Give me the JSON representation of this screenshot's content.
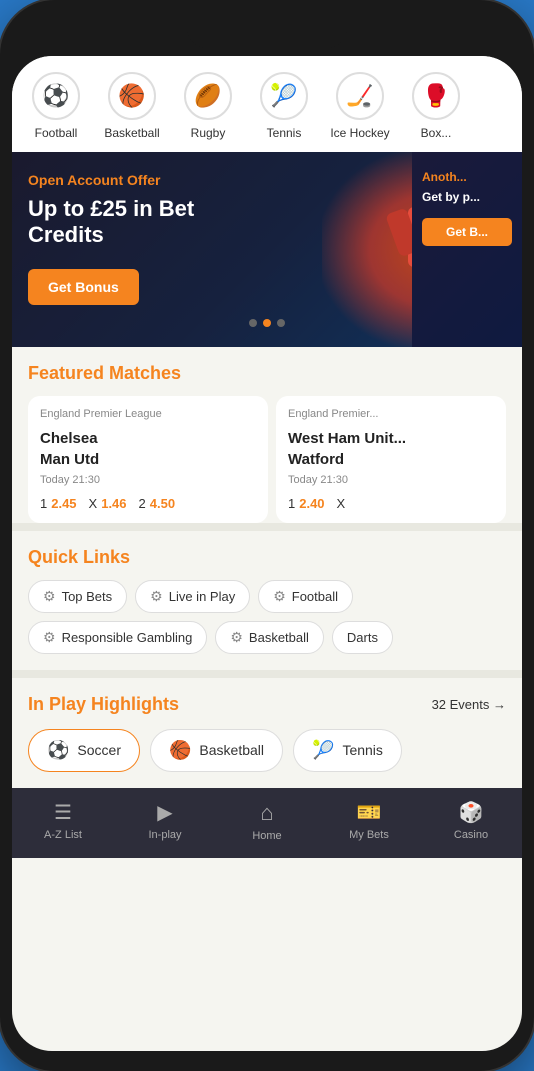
{
  "sports": [
    {
      "id": "football",
      "label": "Football",
      "icon": "⚽"
    },
    {
      "id": "basketball",
      "label": "Basketball",
      "icon": "🏀"
    },
    {
      "id": "rugby",
      "label": "Rugby",
      "icon": "🏉"
    },
    {
      "id": "tennis",
      "label": "Tennis",
      "icon": "🎾"
    },
    {
      "id": "ice-hockey",
      "label": "Ice Hockey",
      "icon": "🏒"
    },
    {
      "id": "boxing",
      "label": "Box...",
      "icon": "🥊"
    }
  ],
  "banner": {
    "offer_label": "Open Account Offer",
    "title": "Up to £25 in Bet Credits",
    "btn_label": "Get Bonus",
    "second_label": "Anoth...",
    "second_text": "Get by p...",
    "second_btn": "Get B..."
  },
  "featured": {
    "title": "Featured Matches",
    "matches": [
      {
        "league": "England Premier League",
        "team1": "Chelsea",
        "team2": "Man Utd",
        "time": "Today 21:30",
        "odd1": "2.45",
        "oddX": "1.46",
        "odd2": "4.50"
      },
      {
        "league": "England Premier...",
        "team1": "West Ham Unit...",
        "team2": "Watford",
        "time": "Today 21:30",
        "odd1": "2.40",
        "oddX": "X",
        "odd2": ""
      }
    ]
  },
  "quick_links": {
    "title": "Quick Links",
    "items": [
      {
        "label": "Top Bets",
        "icon": "⚙"
      },
      {
        "label": "Live in Play",
        "icon": "⚙"
      },
      {
        "label": "Football",
        "icon": "⚙"
      },
      {
        "label": "Responsible Gambling",
        "icon": "⚙"
      },
      {
        "label": "Basketball",
        "icon": "⚙"
      },
      {
        "label": "Darts",
        "icon": ""
      }
    ]
  },
  "inplay": {
    "title": "In Play Highlights",
    "events_label": "32 Events →",
    "tabs": [
      {
        "id": "soccer",
        "label": "Soccer",
        "icon": "⚽",
        "active": true
      },
      {
        "id": "basketball",
        "label": "Basketball",
        "icon": "🏀",
        "active": false
      },
      {
        "id": "tennis",
        "label": "Tennis",
        "icon": "🎾",
        "active": false
      }
    ]
  },
  "bottom_nav": [
    {
      "id": "az-list",
      "label": "A-Z List",
      "icon": "☰"
    },
    {
      "id": "in-play",
      "label": "In-play",
      "icon": "▶"
    },
    {
      "id": "home",
      "label": "Home",
      "icon": "⌂"
    },
    {
      "id": "my-bets",
      "label": "My Bets",
      "icon": "🎫"
    },
    {
      "id": "casino",
      "label": "Casino",
      "icon": "🎲"
    }
  ]
}
